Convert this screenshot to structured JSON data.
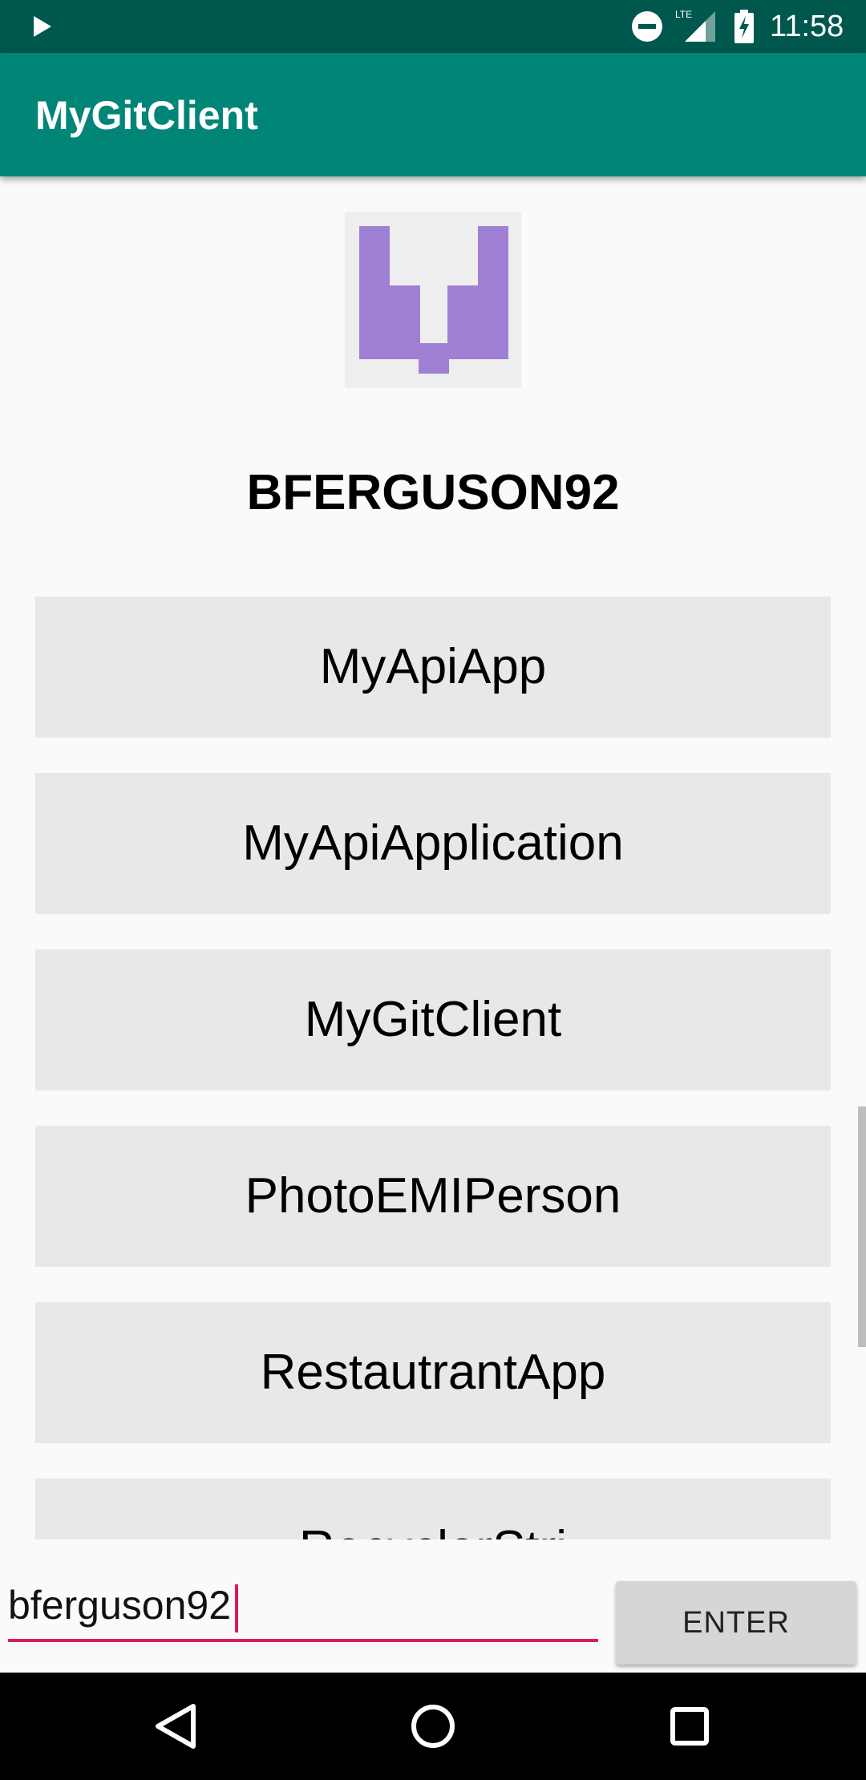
{
  "status_bar": {
    "time": "11:58",
    "network_label": "LTE",
    "icons": [
      "play-icon",
      "do-not-disturb-icon",
      "lte-signal-icon",
      "battery-charging-icon"
    ]
  },
  "app_bar": {
    "title": "MyGitClient",
    "color": "#008577",
    "status_color": "#00574d"
  },
  "profile": {
    "avatar_icon": "identicon-avatar",
    "username_heading": "BFERGUSON92"
  },
  "repositories": [
    {
      "label": "MyApiApp"
    },
    {
      "label": "MyApiApplication"
    },
    {
      "label": "MyGitClient"
    },
    {
      "label": "PhotoEMIPerson"
    },
    {
      "label": "RestautrantApp"
    },
    {
      "label": "RecyclerStri"
    }
  ],
  "search": {
    "value": "bferguson92",
    "accent_color": "#d81b60",
    "enter_label": "ENTER"
  },
  "nav_bar": {
    "icons": [
      "back-icon",
      "home-icon",
      "recents-icon"
    ]
  }
}
